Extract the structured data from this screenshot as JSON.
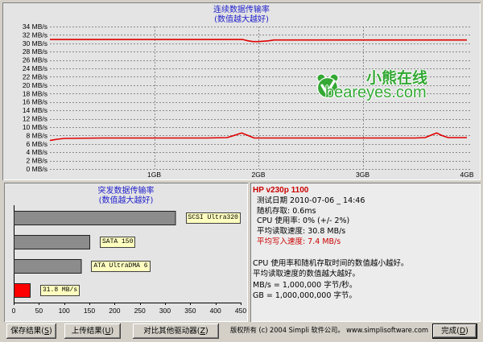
{
  "chart_data": [
    {
      "type": "line",
      "title": "连续数据传输率",
      "subtitle": "(数值越大越好)",
      "xlabel": "",
      "ylabel": "",
      "xlim": [
        0,
        4
      ],
      "ylim": [
        0,
        34
      ],
      "xticks": [
        1,
        2,
        3,
        4
      ],
      "xtick_labels": [
        "1GB",
        "2GB",
        "3GB",
        "4GB"
      ],
      "yticks": [
        0,
        2,
        4,
        6,
        8,
        10,
        12,
        14,
        16,
        18,
        20,
        22,
        24,
        26,
        28,
        30,
        32,
        34
      ],
      "ytick_labels": [
        "0 MB/s",
        "2 MB/s",
        "4 MB/s",
        "6 MB/s",
        "8 MB/s",
        "10 MB/s",
        "12 MB/s",
        "14 MB/s",
        "16 MB/s",
        "18 MB/s",
        "20 MB/s",
        "22 MB/s",
        "24 MB/s",
        "26 MB/s",
        "28 MB/s",
        "30 MB/s",
        "32 MB/s",
        "34 MB/s"
      ],
      "grid": true,
      "series": [
        {
          "color": "#e00000",
          "x": [
            0,
            0.25,
            0.5,
            0.75,
            1,
            1.25,
            1.5,
            1.75,
            1.85,
            1.9,
            1.95,
            2.0,
            2.05,
            2.1,
            2.15,
            2.25,
            2.5,
            2.75,
            3,
            3.25,
            3.5,
            3.75,
            4
          ],
          "y": [
            30.9,
            30.9,
            30.9,
            30.9,
            30.9,
            30.9,
            30.9,
            30.9,
            30.9,
            30.6,
            30.4,
            30.4,
            30.5,
            30.6,
            30.8,
            30.8,
            30.8,
            30.8,
            30.8,
            30.8,
            30.8,
            30.8,
            30.8
          ]
        },
        {
          "color": "#e00000",
          "x": [
            0,
            0.07,
            0.14,
            0.5,
            1,
            1.5,
            1.7,
            1.78,
            1.84,
            1.9,
            1.96,
            2.5,
            3,
            3.5,
            3.6,
            3.66,
            3.71,
            3.76,
            3.82,
            4
          ],
          "y": [
            6.8,
            7.1,
            7.3,
            7.4,
            7.4,
            7.4,
            7.5,
            8.1,
            8.6,
            8.0,
            7.4,
            7.4,
            7.4,
            7.4,
            7.5,
            8.1,
            8.6,
            8.0,
            7.5,
            7.5
          ]
        }
      ]
    },
    {
      "type": "bar",
      "orientation": "horizontal",
      "title": "突发数据传输率",
      "subtitle": "(数值越大越好)",
      "categories": [
        "SCSI Ultra320",
        "SATA 150",
        "ATA UltraDMA 6",
        "31.8 MB/s"
      ],
      "values": [
        320,
        150,
        133,
        31.8
      ],
      "colors": [
        "#8c8c8c",
        "#8c8c8c",
        "#8c8c8c",
        "#ff0000"
      ],
      "label_bg": "#ffffc0",
      "xlim": [
        0,
        450
      ],
      "xticks": [
        0,
        50,
        100,
        150,
        200,
        250,
        300,
        350,
        400,
        450
      ],
      "xtick_labels": [
        "0",
        "50",
        "100",
        "150",
        "200",
        "250",
        "300",
        "350",
        "400",
        "450"
      ]
    }
  ],
  "watermark": {
    "cn": "小熊在线",
    "en": "beareyes.com",
    "color": "#33a833",
    "icon": "beareyes-logo-icon"
  },
  "info": {
    "drive": "HP v230p 1100",
    "stats": [
      "测试日期 2010-07-06 _ 14:46",
      "随机存取: 0.6ms",
      "CPU 使用率: 0% (+/- 2%)",
      "平均读取速度: 30.8 MB/s",
      "平均写入速度: 7.4 MB/s"
    ],
    "notes": [
      "CPU 使用率和随机存取时间的数值越小越好。",
      "平均读取速度的数值越大越好。",
      "MB/s = 1,000,000 字节/秒。",
      "GB = 1,000,000,000 字节。"
    ],
    "highlight_color": "#cc0000"
  },
  "buttons": {
    "save": {
      "pre": "保存结果(",
      "key": "S",
      "post": ")"
    },
    "upload": {
      "pre": "上传结果(",
      "key": "U",
      "post": ")"
    },
    "compare": {
      "pre": "对比其他驱动器(",
      "key": "Z",
      "post": ")"
    },
    "done": {
      "pre": "完成(",
      "key": "D",
      "post": ")"
    }
  },
  "footer": {
    "copyright": "版权所有 (c) 2004 Simpli 软件公司。 www.simplisoftware.com"
  },
  "colors": {
    "title_blue": "#2222cc",
    "dialog_bg": "#d4d0c8"
  }
}
